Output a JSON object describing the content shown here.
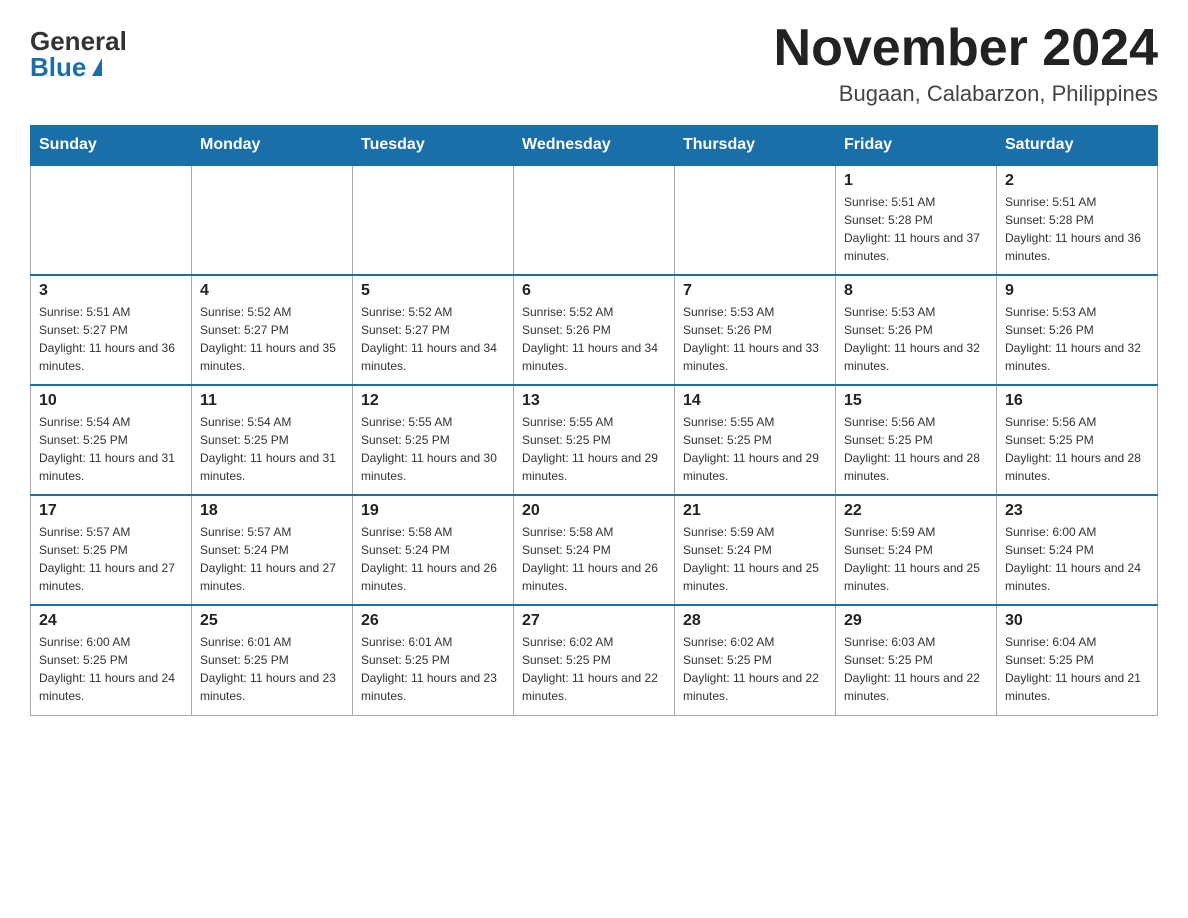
{
  "logo": {
    "general": "General",
    "blue": "Blue"
  },
  "header": {
    "month": "November 2024",
    "location": "Bugaan, Calabarzon, Philippines"
  },
  "weekdays": [
    "Sunday",
    "Monday",
    "Tuesday",
    "Wednesday",
    "Thursday",
    "Friday",
    "Saturday"
  ],
  "weeks": [
    [
      {
        "day": "",
        "info": ""
      },
      {
        "day": "",
        "info": ""
      },
      {
        "day": "",
        "info": ""
      },
      {
        "day": "",
        "info": ""
      },
      {
        "day": "",
        "info": ""
      },
      {
        "day": "1",
        "info": "Sunrise: 5:51 AM\nSunset: 5:28 PM\nDaylight: 11 hours and 37 minutes."
      },
      {
        "day": "2",
        "info": "Sunrise: 5:51 AM\nSunset: 5:28 PM\nDaylight: 11 hours and 36 minutes."
      }
    ],
    [
      {
        "day": "3",
        "info": "Sunrise: 5:51 AM\nSunset: 5:27 PM\nDaylight: 11 hours and 36 minutes."
      },
      {
        "day": "4",
        "info": "Sunrise: 5:52 AM\nSunset: 5:27 PM\nDaylight: 11 hours and 35 minutes."
      },
      {
        "day": "5",
        "info": "Sunrise: 5:52 AM\nSunset: 5:27 PM\nDaylight: 11 hours and 34 minutes."
      },
      {
        "day": "6",
        "info": "Sunrise: 5:52 AM\nSunset: 5:26 PM\nDaylight: 11 hours and 34 minutes."
      },
      {
        "day": "7",
        "info": "Sunrise: 5:53 AM\nSunset: 5:26 PM\nDaylight: 11 hours and 33 minutes."
      },
      {
        "day": "8",
        "info": "Sunrise: 5:53 AM\nSunset: 5:26 PM\nDaylight: 11 hours and 32 minutes."
      },
      {
        "day": "9",
        "info": "Sunrise: 5:53 AM\nSunset: 5:26 PM\nDaylight: 11 hours and 32 minutes."
      }
    ],
    [
      {
        "day": "10",
        "info": "Sunrise: 5:54 AM\nSunset: 5:25 PM\nDaylight: 11 hours and 31 minutes."
      },
      {
        "day": "11",
        "info": "Sunrise: 5:54 AM\nSunset: 5:25 PM\nDaylight: 11 hours and 31 minutes."
      },
      {
        "day": "12",
        "info": "Sunrise: 5:55 AM\nSunset: 5:25 PM\nDaylight: 11 hours and 30 minutes."
      },
      {
        "day": "13",
        "info": "Sunrise: 5:55 AM\nSunset: 5:25 PM\nDaylight: 11 hours and 29 minutes."
      },
      {
        "day": "14",
        "info": "Sunrise: 5:55 AM\nSunset: 5:25 PM\nDaylight: 11 hours and 29 minutes."
      },
      {
        "day": "15",
        "info": "Sunrise: 5:56 AM\nSunset: 5:25 PM\nDaylight: 11 hours and 28 minutes."
      },
      {
        "day": "16",
        "info": "Sunrise: 5:56 AM\nSunset: 5:25 PM\nDaylight: 11 hours and 28 minutes."
      }
    ],
    [
      {
        "day": "17",
        "info": "Sunrise: 5:57 AM\nSunset: 5:25 PM\nDaylight: 11 hours and 27 minutes."
      },
      {
        "day": "18",
        "info": "Sunrise: 5:57 AM\nSunset: 5:24 PM\nDaylight: 11 hours and 27 minutes."
      },
      {
        "day": "19",
        "info": "Sunrise: 5:58 AM\nSunset: 5:24 PM\nDaylight: 11 hours and 26 minutes."
      },
      {
        "day": "20",
        "info": "Sunrise: 5:58 AM\nSunset: 5:24 PM\nDaylight: 11 hours and 26 minutes."
      },
      {
        "day": "21",
        "info": "Sunrise: 5:59 AM\nSunset: 5:24 PM\nDaylight: 11 hours and 25 minutes."
      },
      {
        "day": "22",
        "info": "Sunrise: 5:59 AM\nSunset: 5:24 PM\nDaylight: 11 hours and 25 minutes."
      },
      {
        "day": "23",
        "info": "Sunrise: 6:00 AM\nSunset: 5:24 PM\nDaylight: 11 hours and 24 minutes."
      }
    ],
    [
      {
        "day": "24",
        "info": "Sunrise: 6:00 AM\nSunset: 5:25 PM\nDaylight: 11 hours and 24 minutes."
      },
      {
        "day": "25",
        "info": "Sunrise: 6:01 AM\nSunset: 5:25 PM\nDaylight: 11 hours and 23 minutes."
      },
      {
        "day": "26",
        "info": "Sunrise: 6:01 AM\nSunset: 5:25 PM\nDaylight: 11 hours and 23 minutes."
      },
      {
        "day": "27",
        "info": "Sunrise: 6:02 AM\nSunset: 5:25 PM\nDaylight: 11 hours and 22 minutes."
      },
      {
        "day": "28",
        "info": "Sunrise: 6:02 AM\nSunset: 5:25 PM\nDaylight: 11 hours and 22 minutes."
      },
      {
        "day": "29",
        "info": "Sunrise: 6:03 AM\nSunset: 5:25 PM\nDaylight: 11 hours and 22 minutes."
      },
      {
        "day": "30",
        "info": "Sunrise: 6:04 AM\nSunset: 5:25 PM\nDaylight: 11 hours and 21 minutes."
      }
    ]
  ]
}
